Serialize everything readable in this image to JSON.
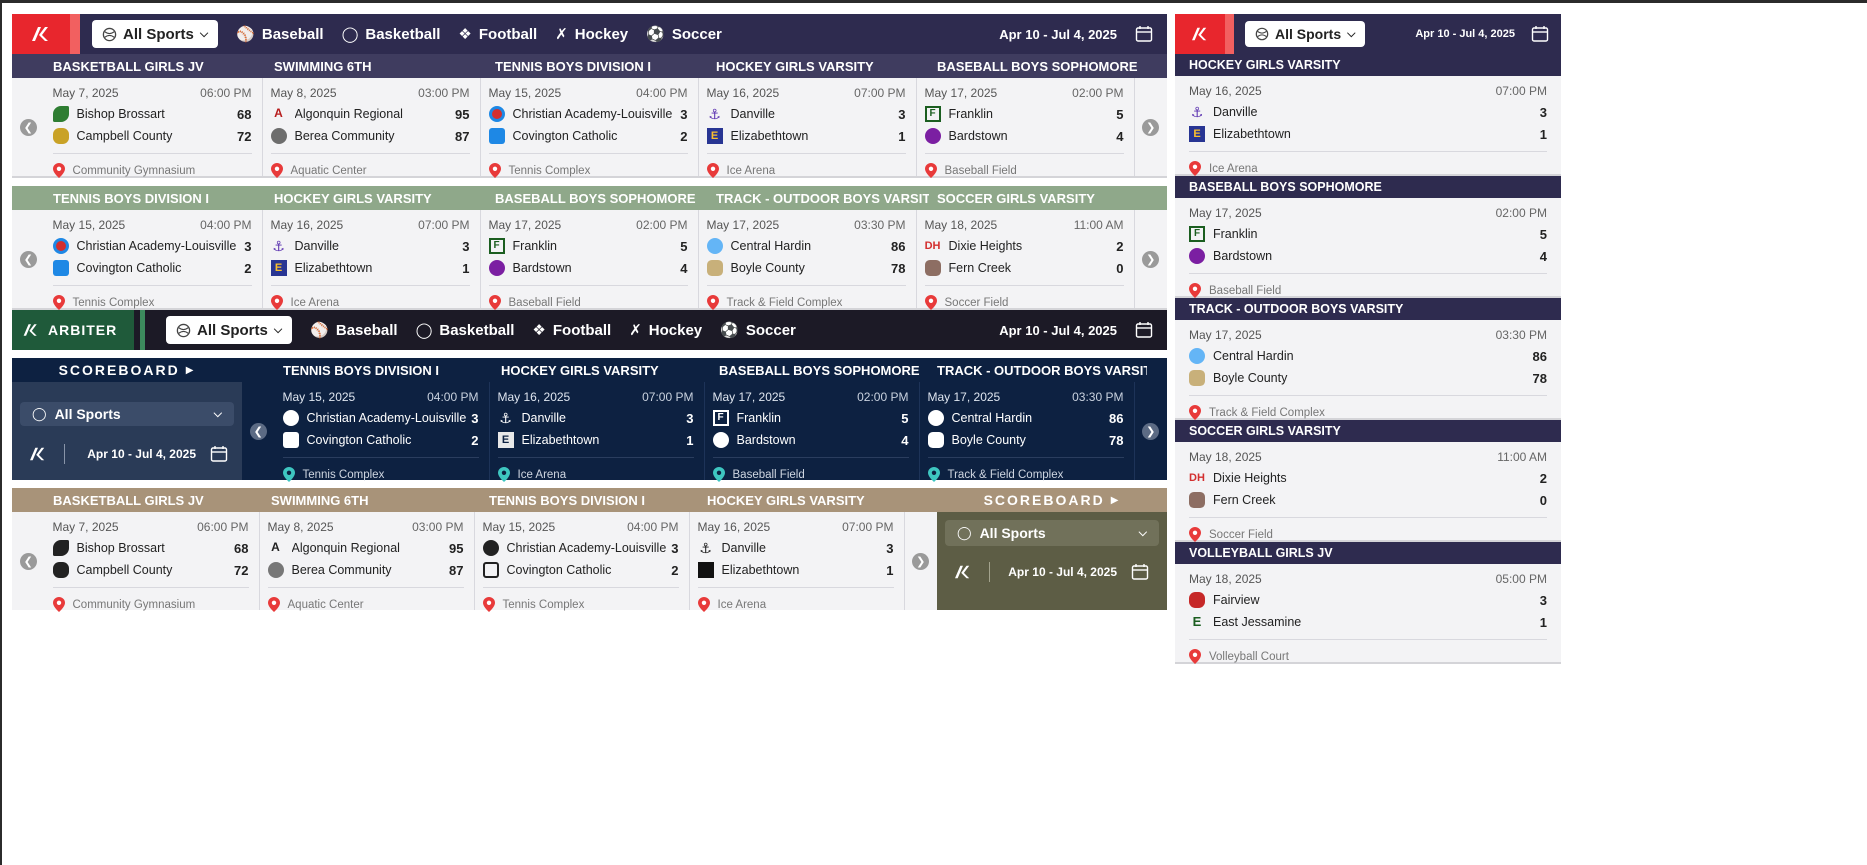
{
  "widget1": {
    "all_sports": "All Sports",
    "tabs": [
      "Baseball",
      "Basketball",
      "Football",
      "Hockey",
      "Soccer"
    ],
    "date_range": "Apr 10 - Jul 4, 2025",
    "headers": [
      "BASKETBALL GIRLS JV",
      "SWIMMING 6TH",
      "TENNIS BOYS DIVISION I",
      "HOCKEY GIRLS VARSITY",
      "BASEBALL BOYS SOPHOMORE"
    ],
    "cards": [
      {
        "date": "May 7, 2025",
        "time": "06:00 PM",
        "home": "Bishop Brossart",
        "home_score": "68",
        "away": "Campbell County",
        "away_score": "72",
        "venue": "Community Gymnasium"
      },
      {
        "date": "May 8, 2025",
        "time": "03:00 PM",
        "home": "Algonquin Regional",
        "home_score": "95",
        "away": "Berea Community",
        "away_score": "87",
        "venue": "Aquatic Center"
      },
      {
        "date": "May 15, 2025",
        "time": "04:00 PM",
        "home": "Christian Academy-Louisville",
        "home_score": "3",
        "away": "Covington Catholic",
        "away_score": "2",
        "venue": "Tennis Complex"
      },
      {
        "date": "May 16, 2025",
        "time": "07:00 PM",
        "home": "Danville",
        "home_score": "3",
        "away": "Elizabethtown",
        "away_score": "1",
        "venue": "Ice Arena"
      },
      {
        "date": "May 17, 2025",
        "time": "02:00 PM",
        "home": "Franklin",
        "home_score": "5",
        "away": "Bardstown",
        "away_score": "4",
        "venue": "Baseball Field"
      }
    ]
  },
  "widget2": {
    "headers": [
      "TENNIS BOYS DIVISION I",
      "HOCKEY GIRLS VARSITY",
      "BASEBALL BOYS SOPHOMORE",
      "TRACK - OUTDOOR BOYS VARSITY",
      "SOCCER GIRLS VARSITY"
    ],
    "cards": [
      {
        "date": "May 15, 2025",
        "time": "04:00 PM",
        "home": "Christian Academy-Louisville",
        "home_score": "3",
        "away": "Covington Catholic",
        "away_score": "2",
        "venue": "Tennis Complex"
      },
      {
        "date": "May 16, 2025",
        "time": "07:00 PM",
        "home": "Danville",
        "home_score": "3",
        "away": "Elizabethtown",
        "away_score": "1",
        "venue": "Ice Arena"
      },
      {
        "date": "May 17, 2025",
        "time": "02:00 PM",
        "home": "Franklin",
        "home_score": "5",
        "away": "Bardstown",
        "away_score": "4",
        "venue": "Baseball Field"
      },
      {
        "date": "May 17, 2025",
        "time": "03:30 PM",
        "home": "Central Hardin",
        "home_score": "86",
        "away": "Boyle County",
        "away_score": "78",
        "venue": "Track & Field Complex"
      },
      {
        "date": "May 18, 2025",
        "time": "11:00 AM",
        "home": "Dixie Heights",
        "home_score": "2",
        "away": "Fern Creek",
        "away_score": "0",
        "venue": "Soccer Field"
      }
    ]
  },
  "widget3": {
    "brand": "ARBITER",
    "all_sports": "All Sports",
    "tabs": [
      "Baseball",
      "Basketball",
      "Football",
      "Hockey",
      "Soccer"
    ],
    "date_range": "Apr 10 - Jul 4, 2025"
  },
  "widget4": {
    "scoreboard_label": "SCOREBOARD",
    "all_sports": "All Sports",
    "date_range": "Apr 10 - Jul 4, 2025",
    "headers": [
      "TENNIS BOYS DIVISION I",
      "HOCKEY GIRLS VARSITY",
      "BASEBALL BOYS SOPHOMORE",
      "TRACK - OUTDOOR BOYS VARSITY"
    ],
    "cards": [
      {
        "date": "May 15, 2025",
        "time": "04:00 PM",
        "home": "Christian Academy-Louisville",
        "home_score": "3",
        "away": "Covington Catholic",
        "away_score": "2",
        "venue": "Tennis Complex"
      },
      {
        "date": "May 16, 2025",
        "time": "07:00 PM",
        "home": "Danville",
        "home_score": "3",
        "away": "Elizabethtown",
        "away_score": "1",
        "venue": "Ice Arena"
      },
      {
        "date": "May 17, 2025",
        "time": "02:00 PM",
        "home": "Franklin",
        "home_score": "5",
        "away": "Bardstown",
        "away_score": "4",
        "venue": "Baseball Field"
      },
      {
        "date": "May 17, 2025",
        "time": "03:30 PM",
        "home": "Central Hardin",
        "home_score": "86",
        "away": "Boyle County",
        "away_score": "78",
        "venue": "Track & Field Complex"
      }
    ]
  },
  "widget5": {
    "scoreboard_label": "SCOREBOARD",
    "all_sports": "All Sports",
    "date_range": "Apr 10 - Jul 4, 2025",
    "headers": [
      "BASKETBALL GIRLS JV",
      "SWIMMING 6TH",
      "TENNIS BOYS DIVISION I",
      "HOCKEY GIRLS VARSITY"
    ],
    "cards": [
      {
        "date": "May 7, 2025",
        "time": "06:00 PM",
        "home": "Bishop Brossart",
        "home_score": "68",
        "away": "Campbell County",
        "away_score": "72",
        "venue": "Community Gymnasium"
      },
      {
        "date": "May 8, 2025",
        "time": "03:00 PM",
        "home": "Algonquin Regional",
        "home_score": "95",
        "away": "Berea Community",
        "away_score": "87",
        "venue": "Aquatic Center"
      },
      {
        "date": "May 15, 2025",
        "time": "04:00 PM",
        "home": "Christian Academy-Louisville",
        "home_score": "3",
        "away": "Covington Catholic",
        "away_score": "2",
        "venue": "Tennis Complex"
      },
      {
        "date": "May 16, 2025",
        "time": "07:00 PM",
        "home": "Danville",
        "home_score": "3",
        "away": "Elizabethtown",
        "away_score": "1",
        "venue": "Ice Arena"
      }
    ]
  },
  "side": {
    "all_sports": "All Sports",
    "date_range": "Apr 10 - Jul 4, 2025",
    "games": [
      {
        "header": "HOCKEY GIRLS VARSITY",
        "date": "May 16, 2025",
        "time": "07:00 PM",
        "home": "Danville",
        "home_score": "3",
        "away": "Elizabethtown",
        "away_score": "1",
        "venue": "Ice Arena"
      },
      {
        "header": "BASEBALL BOYS SOPHOMORE",
        "date": "May 17, 2025",
        "time": "02:00 PM",
        "home": "Franklin",
        "home_score": "5",
        "away": "Bardstown",
        "away_score": "4",
        "venue": "Baseball Field"
      },
      {
        "header": "TRACK - OUTDOOR BOYS VARSITY",
        "date": "May 17, 2025",
        "time": "03:30 PM",
        "home": "Central Hardin",
        "home_score": "86",
        "away": "Boyle County",
        "away_score": "78",
        "venue": "Track & Field Complex"
      },
      {
        "header": "SOCCER GIRLS VARSITY",
        "date": "May 18, 2025",
        "time": "11:00 AM",
        "home": "Dixie Heights",
        "home_score": "2",
        "away": "Fern Creek",
        "away_score": "0",
        "venue": "Soccer Field"
      },
      {
        "header": "VOLLEYBALL GIRLS JV",
        "date": "May 18, 2025",
        "time": "05:00 PM",
        "home": "Fairview",
        "home_score": "3",
        "away": "East Jessamine",
        "away_score": "1",
        "venue": "Volleyball Court"
      }
    ]
  },
  "colors": {
    "navy_bar": "#2e2b4f",
    "red_accent": "#e8262d",
    "sage_header": "#8fa88a",
    "arbiter_green": "#1f5a3a",
    "dark_navy": "#0d2141",
    "tan_header": "#a89379",
    "olive_panel": "#5d5d45",
    "pin_red": "#e83a3a",
    "pin_teal": "#3ec6c0"
  }
}
